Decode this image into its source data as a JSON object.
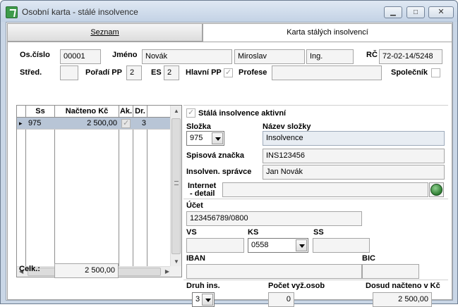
{
  "window": {
    "title": "Osobní karta - stálé insolvence"
  },
  "tabs": [
    {
      "label": "Seznam"
    },
    {
      "label": "Karta stálých insolvencí"
    }
  ],
  "header": {
    "oscislo_label": "Os.číslo",
    "oscislo_value": "00001",
    "jmeno_label": "Jméno",
    "surname": "Novák",
    "firstname": "Miroslav",
    "title_value": "Ing.",
    "rc_label": "RČ",
    "rc_value": "72-02-14/5248",
    "stred_label": "Střed.",
    "stred_value": "",
    "poradi_label": "Pořadí PP",
    "poradi_value": "2",
    "es_label": "ES",
    "es_value": "2",
    "hlavni_label": "Hlavní PP",
    "profese_label": "Profese",
    "profese_value": "",
    "spolecnik_label": "Společník"
  },
  "grid": {
    "columns": [
      "Ss",
      "Načteno Kč",
      "Ak.",
      "Dr."
    ],
    "rows": [
      {
        "ss": "975",
        "nacteno": "2 500,00",
        "dr": "3"
      }
    ]
  },
  "celk": {
    "label": "Celk.:",
    "value": "2 500,00"
  },
  "detail": {
    "active_label": "Stálá insolvence aktivní",
    "slozka_label": "Složka",
    "slozka_value": "975",
    "nazev_label": "Název složky",
    "nazev_value": "Insolvence",
    "spisova_label": "Spisová značka",
    "spisova_value": "INS123456",
    "spravce_label": "Insolven. správce",
    "spravce_value": "Jan Novák",
    "internet_label1": "Internet",
    "internet_label2": "- detail",
    "internet_value": "",
    "ucet_label": "Účet",
    "ucet_value": "123456789/0800",
    "vs_label": "VS",
    "vs_value": "",
    "ks_label": "KS",
    "ks_value": "0558",
    "ss_label": "SS",
    "ss_value": "",
    "iban_label": "IBAN",
    "iban_value": "",
    "bic_label": "BIC",
    "bic_value": "",
    "druh_label": "Druh ins.",
    "druh_value": "3",
    "pocet_label": "Počet vyž.osob",
    "pocet_value": "0",
    "dosud_label": "Dosud načteno v Kč",
    "dosud_value": "2 500,00"
  }
}
